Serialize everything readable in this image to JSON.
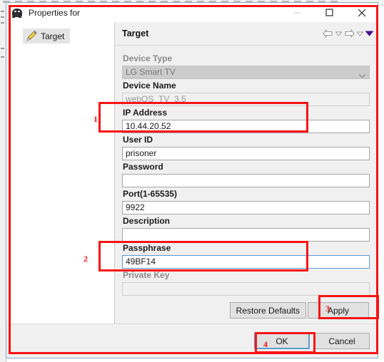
{
  "window": {
    "title": "Properties for",
    "icon": "device-robot-icon",
    "buttons": {
      "minimize": "minimize-icon",
      "maximize": "maximize-icon",
      "close": "close-icon"
    }
  },
  "tree": {
    "items": [
      {
        "label": "Target",
        "icon": "pencil-icon",
        "selected": true
      }
    ]
  },
  "properties": {
    "title": "Target",
    "nav": {
      "back": "back-arrow-icon",
      "back_menu": "chevron-down-icon",
      "forward": "forward-arrow-icon",
      "forward_menu": "chevron-down-icon",
      "view_menu": "filled-chevron-down-icon"
    },
    "fields": [
      {
        "name": "device-type",
        "label": "Device Type",
        "value": "LG Smart TV",
        "control": "select",
        "disabled": true,
        "focused": false
      },
      {
        "name": "device-name",
        "label": "Device Name",
        "value": "webOS_TV_3.5",
        "control": "input",
        "disabled": true,
        "focused": false
      },
      {
        "name": "ip-address",
        "label": "IP Address",
        "value": "10.44.20.52",
        "control": "input",
        "disabled": false,
        "focused": false
      },
      {
        "name": "user-id",
        "label": "User ID",
        "value": "prisoner",
        "control": "input",
        "disabled": false,
        "focused": false
      },
      {
        "name": "password",
        "label": "Password",
        "value": "",
        "control": "input",
        "disabled": false,
        "focused": false
      },
      {
        "name": "port",
        "label": "Port(1-65535)",
        "value": "9922",
        "control": "input",
        "disabled": false,
        "focused": false
      },
      {
        "name": "description",
        "label": "Description",
        "value": "",
        "control": "input",
        "disabled": false,
        "focused": false
      },
      {
        "name": "passphrase",
        "label": "Passphrase",
        "value": "49BF14",
        "control": "input",
        "disabled": false,
        "focused": true
      },
      {
        "name": "private-key",
        "label": "Private Key",
        "value": "",
        "control": "input",
        "disabled": true,
        "focused": false
      }
    ],
    "restore_defaults_label": "Restore Defaults",
    "apply_label": "Apply"
  },
  "footer": {
    "ok_label": "OK",
    "cancel_label": "Cancel"
  },
  "annotations": {
    "accent_color": "#f71414",
    "markers": [
      {
        "number": "1",
        "target": "ip-address-field"
      },
      {
        "number": "2",
        "target": "passphrase-field"
      },
      {
        "number": "3",
        "target": "apply-button"
      },
      {
        "number": "4",
        "target": "ok-button"
      }
    ]
  }
}
